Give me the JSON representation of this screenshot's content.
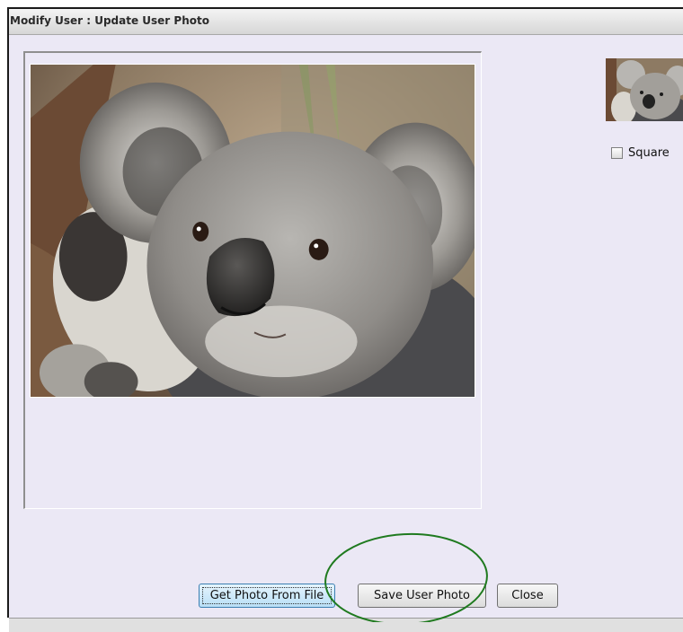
{
  "window": {
    "title": "Modify User : Update User Photo",
    "title_icon": "window-icon"
  },
  "photo": {
    "alt": "Koala photo preview"
  },
  "thumbnail": {
    "alt": "Koala thumbnail"
  },
  "options": {
    "square_label": "Square",
    "square_checked": false
  },
  "buttons": {
    "get_photo": "Get Photo From File",
    "save_photo": "Save User Photo",
    "close": "Close"
  },
  "colors": {
    "dialog_bg": "#ebe8f5",
    "annotation_circle": "#1f7a1f"
  }
}
